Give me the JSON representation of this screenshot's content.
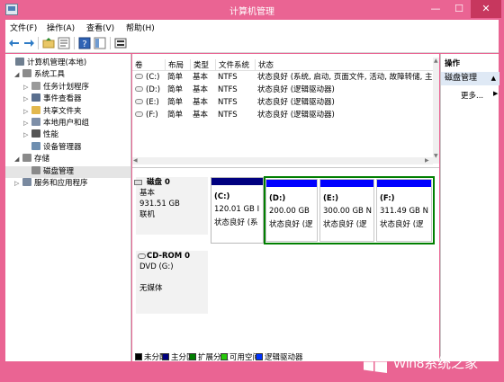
{
  "window": {
    "title": "计算机管理",
    "controls": {
      "minimize": "—",
      "maximize": "☐",
      "close": "✕"
    }
  },
  "menu": [
    "文件(F)",
    "操作(A)",
    "查看(V)",
    "帮助(H)"
  ],
  "toolbar": {
    "icons": [
      "back-icon",
      "forward-icon",
      "up-folder-icon",
      "properties-icon",
      "help-icon",
      "show-hide-icon",
      "disk-view-icon"
    ]
  },
  "tree": [
    {
      "label": "计算机管理(本地)",
      "level": 0,
      "arrow": "",
      "icon": "computer-icon",
      "color": "#6f7f90"
    },
    {
      "label": "系统工具",
      "level": 1,
      "arrow": "◢",
      "icon": "tools-icon",
      "color": "#8b8b8b"
    },
    {
      "label": "任务计划程序",
      "level": 2,
      "arrow": "▷",
      "icon": "clock-icon",
      "color": "#9a9a9a"
    },
    {
      "label": "事件查看器",
      "level": 2,
      "arrow": "▷",
      "icon": "event-viewer-icon",
      "color": "#5a6f8f"
    },
    {
      "label": "共享文件夹",
      "level": 2,
      "arrow": "▷",
      "icon": "shared-folder-icon",
      "color": "#e2b84e"
    },
    {
      "label": "本地用户和组",
      "level": 2,
      "arrow": "▷",
      "icon": "users-icon",
      "color": "#7e8fa8"
    },
    {
      "label": "性能",
      "level": 2,
      "arrow": "▷",
      "icon": "performance-icon",
      "color": "#555555"
    },
    {
      "label": "设备管理器",
      "level": 2,
      "arrow": "",
      "icon": "device-manager-icon",
      "color": "#6f8fb0"
    },
    {
      "label": "存储",
      "level": 1,
      "arrow": "◢",
      "icon": "storage-icon",
      "color": "#8a8a8a"
    },
    {
      "label": "磁盘管理",
      "level": 2,
      "arrow": "",
      "icon": "disk-management-icon",
      "color": "#8a8a8a",
      "selected": true
    },
    {
      "label": "服务和应用程序",
      "level": 1,
      "arrow": "▷",
      "icon": "services-icon",
      "color": "#7a8aa0"
    }
  ],
  "volume_table": {
    "headers": [
      "卷",
      "布局",
      "类型",
      "文件系统",
      "状态"
    ],
    "rows": [
      [
        "(C:)",
        "简单",
        "基本",
        "NTFS",
        "状态良好 (系统, 启动, 页面文件, 活动, 故障转储, 主分"
      ],
      [
        "(D:)",
        "简单",
        "基本",
        "NTFS",
        "状态良好 (逻辑驱动器)"
      ],
      [
        "(E:)",
        "简单",
        "基本",
        "NTFS",
        "状态良好 (逻辑驱动器)"
      ],
      [
        "(F:)",
        "简单",
        "基本",
        "NTFS",
        "状态良好 (逻辑驱动器)"
      ]
    ]
  },
  "disks": [
    {
      "name": "磁盘 0",
      "type": "基本",
      "size": "931.51 GB",
      "status": "联机",
      "partitions": [
        {
          "letter": "(C:)",
          "size": "120.01 GB I",
          "status": "状态良好 (系",
          "kind": "primary"
        },
        {
          "letter": "(D:)",
          "size": "200.00 GB",
          "status": "状态良好 (逻",
          "kind": "logical"
        },
        {
          "letter": "(E:)",
          "size": "300.00 GB N",
          "status": "状态良好 (逻",
          "kind": "logical"
        },
        {
          "letter": "(F:)",
          "size": "311.49 GB N",
          "status": "状态良好 (逻",
          "kind": "logical"
        }
      ]
    },
    {
      "name": "CD-ROM 0",
      "type": "DVD (G:)",
      "size": "",
      "status": "无媒体",
      "partitions": []
    }
  ],
  "legend": [
    {
      "label": "未分配",
      "color": "#000000"
    },
    {
      "label": "主分区",
      "color": "#00007f"
    },
    {
      "label": "扩展分区",
      "color": "#007f00"
    },
    {
      "label": "可用空间",
      "color": "#26c80a"
    },
    {
      "label": "逻辑驱动器",
      "color": "#0033ff"
    }
  ],
  "actions": {
    "title": "操作",
    "section": "磁盘管理",
    "more": "更多..."
  },
  "watermark": {
    "text": "Win8系统之家"
  },
  "colors": {
    "primary_bar": "#00007f",
    "logical_bar": "#0000ff",
    "extended_border": "#007f00",
    "accent": "#ea6493"
  }
}
